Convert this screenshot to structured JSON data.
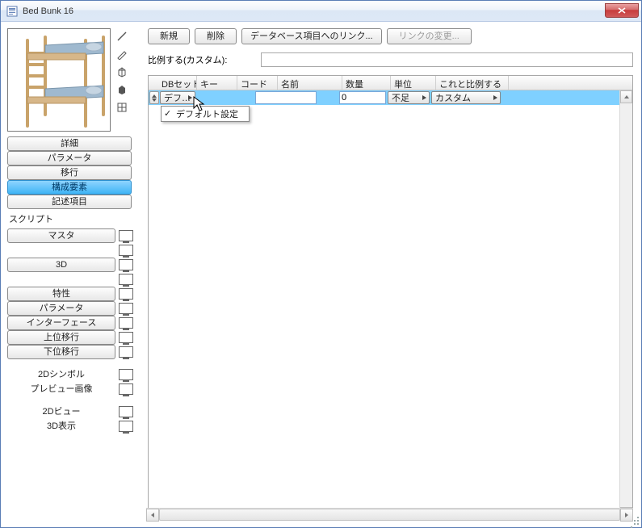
{
  "window": {
    "title": "Bed Bunk 16"
  },
  "toolbar": {
    "new_label": "新規",
    "delete_label": "削除",
    "link_db_label": "データベース項目へのリンク...",
    "change_link_label": "リンクの変更..."
  },
  "prop": {
    "proportional_label": "比例する(カスタム):",
    "proportional_value": ""
  },
  "nav": {
    "items": [
      {
        "label": "詳細",
        "selected": false
      },
      {
        "label": "パラメータ",
        "selected": false
      },
      {
        "label": "移行",
        "selected": false
      },
      {
        "label": "構成要素",
        "selected": true
      },
      {
        "label": "記述項目",
        "selected": false
      }
    ]
  },
  "script_section_label": "スクリプト",
  "scripts": {
    "group1": [
      {
        "label": "マスタ",
        "button": true
      },
      {
        "label": "",
        "button": false
      },
      {
        "label": "3D",
        "button": true
      },
      {
        "label": "",
        "button": false
      },
      {
        "label": "特性",
        "button": true
      },
      {
        "label": "パラメータ",
        "button": true
      },
      {
        "label": "インターフェース",
        "button": true
      },
      {
        "label": "上位移行",
        "button": true
      },
      {
        "label": "下位移行",
        "button": true
      }
    ],
    "group2": [
      {
        "label": "2Dシンボル",
        "button": false
      },
      {
        "label": "プレビュー画像",
        "button": false
      }
    ],
    "group3": [
      {
        "label": "2Dビュー",
        "button": false
      },
      {
        "label": "3D表示",
        "button": false
      }
    ]
  },
  "table": {
    "headers": {
      "dbset": "DBセット",
      "key": "キー",
      "code": "コード",
      "name": "名前",
      "qty": "数量",
      "unit": "単位",
      "compare": "これと比例する"
    },
    "row": {
      "dbset_display": "デフ…",
      "code_value": "",
      "qty_value": "0",
      "unit_value": "不足",
      "compare_value": "カスタム"
    },
    "dropdown": {
      "item1": "デフォルト設定"
    }
  },
  "colors": {
    "selection": "#7fd0ff"
  }
}
